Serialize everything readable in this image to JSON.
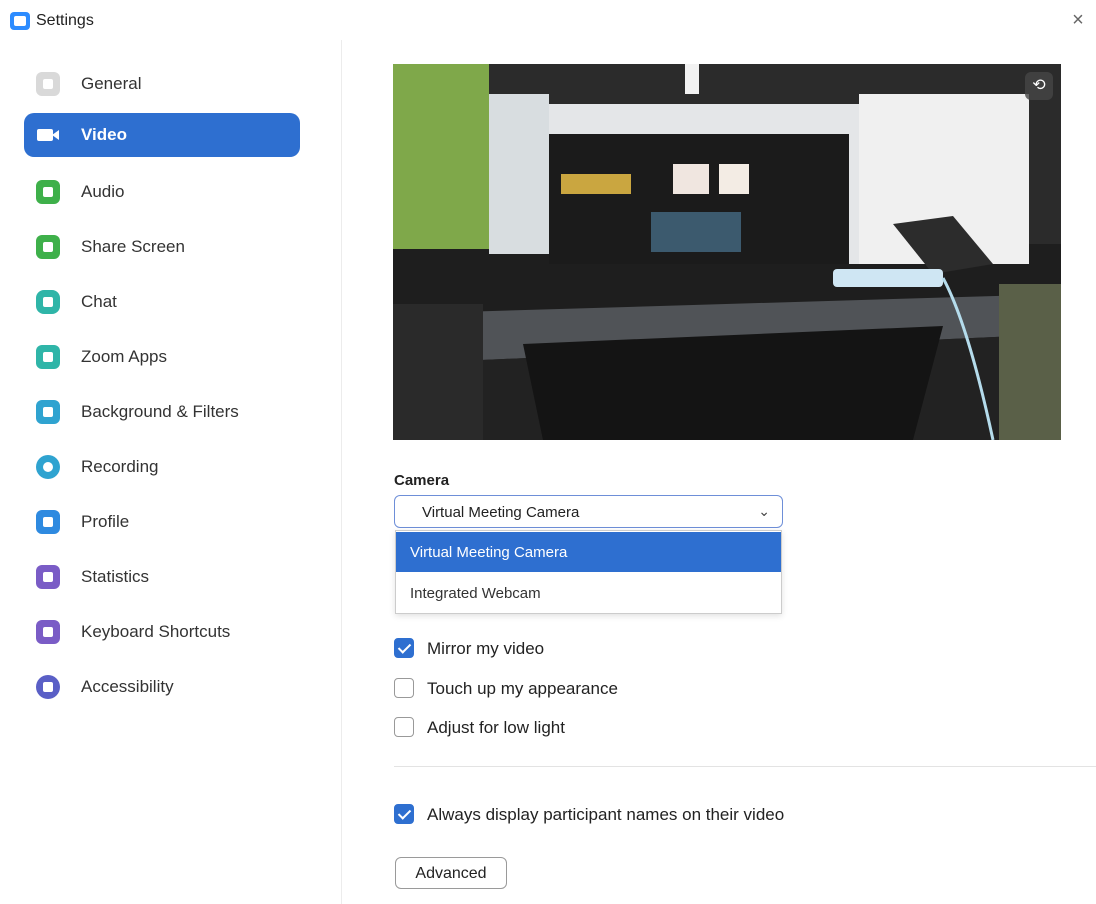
{
  "window": {
    "title": "Settings",
    "close_symbol": "×"
  },
  "sidebar": {
    "items": [
      {
        "label": "General",
        "icon": "gear-icon"
      },
      {
        "label": "Video",
        "icon": "video-camera-icon",
        "active": true
      },
      {
        "label": "Audio",
        "icon": "headphones-icon"
      },
      {
        "label": "Share Screen",
        "icon": "share-screen-icon"
      },
      {
        "label": "Chat",
        "icon": "chat-bubble-icon"
      },
      {
        "label": "Zoom Apps",
        "icon": "apps-icon"
      },
      {
        "label": "Background & Filters",
        "icon": "portrait-icon"
      },
      {
        "label": "Recording",
        "icon": "record-icon"
      },
      {
        "label": "Profile",
        "icon": "user-icon"
      },
      {
        "label": "Statistics",
        "icon": "bar-chart-icon"
      },
      {
        "label": "Keyboard Shortcuts",
        "icon": "keyboard-icon"
      },
      {
        "label": "Accessibility",
        "icon": "accessibility-icon"
      }
    ]
  },
  "main": {
    "preview_rotate_symbol": "⟲",
    "camera": {
      "label": "Camera",
      "selected": "Virtual Meeting Camera",
      "chevron": "⌄",
      "options": [
        "Virtual Meeting Camera",
        "Integrated Webcam"
      ]
    },
    "options": [
      {
        "label": "Mirror my video",
        "checked": true
      },
      {
        "label": "Touch up my appearance",
        "checked": false
      },
      {
        "label": "Adjust for low light",
        "checked": false
      }
    ],
    "names_option": {
      "label": "Always display participant names on their video",
      "checked": true
    },
    "advanced_label": "Advanced"
  },
  "colors": {
    "accent": "#2e6fd0",
    "select_border": "#6e8fd8"
  }
}
